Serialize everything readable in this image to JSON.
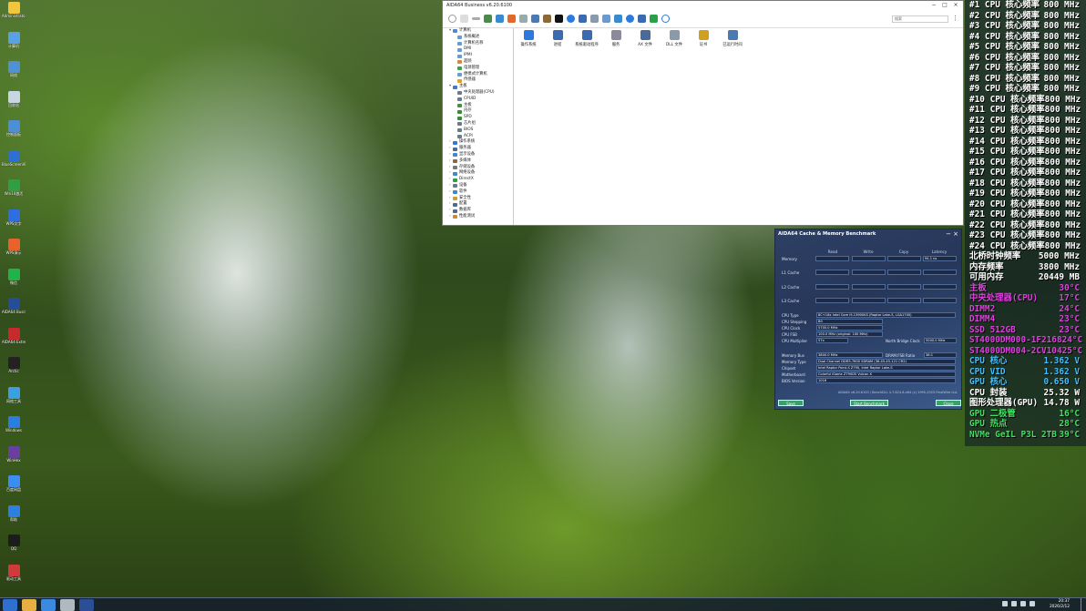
{
  "desktop_icons": [
    {
      "label": "Administrator",
      "icon": "user-folder-icon",
      "color": "#f3c53d"
    },
    {
      "label": "计算机",
      "icon": "computer-icon",
      "color": "#5aa0e6"
    },
    {
      "label": "网络",
      "icon": "network-icon",
      "color": "#4f90d6"
    },
    {
      "label": "回收站",
      "icon": "recycle-bin-icon",
      "color": "#c8d6e4"
    },
    {
      "label": "控制面板",
      "icon": "control-panel-icon",
      "color": "#4c8fd8"
    },
    {
      "label": "BlueScreenView",
      "icon": "bluescreen-icon",
      "color": "#2f6fd0"
    },
    {
      "label": "Win10激活",
      "icon": "activation-icon",
      "color": "#2ea043"
    },
    {
      "label": "WPS文字",
      "icon": "wps-writer-icon",
      "color": "#2f6ee0"
    },
    {
      "label": "WPS演示",
      "icon": "wps-presentation-icon",
      "color": "#e8632c"
    },
    {
      "label": "微信",
      "icon": "wechat-icon",
      "color": "#20b34a"
    },
    {
      "label": "AIDA64 Business",
      "icon": "aida64-icon",
      "color": "#254d9a"
    },
    {
      "label": "AIDA64 Extreme",
      "icon": "aida64-red-icon",
      "color": "#c72a2a"
    },
    {
      "label": "Arctic",
      "icon": "arctic-icon",
      "color": "#222222"
    },
    {
      "label": "网络工具",
      "icon": "net-tool-icon",
      "color": "#3aa0e0"
    },
    {
      "label": "Windows",
      "icon": "windows-icon",
      "color": "#2a7ee0"
    },
    {
      "label": "WinHex",
      "icon": "winhex-icon",
      "color": "#6b3fa0"
    },
    {
      "label": "百度网盘",
      "icon": "baidu-disk-icon",
      "color": "#3b8ef0"
    },
    {
      "label": "帮助",
      "icon": "help-icon",
      "color": "#2f7fe0"
    },
    {
      "label": "QQ",
      "icon": "qq-icon",
      "color": "#1c1c1c"
    },
    {
      "label": "驱动工具",
      "icon": "driver-tool-icon",
      "color": "#d03a3a"
    }
  ],
  "aida_window": {
    "title": "AIDA64 Business v6.20.6100",
    "search_placeholder": "搜索",
    "tree": [
      {
        "label": "计算机",
        "icon": "computer-icon",
        "color": "#4a8ad8"
      },
      {
        "label": "系统概述",
        "icon": "summary-icon",
        "color": "#6a9ad0"
      },
      {
        "label": "计算机名称",
        "icon": "pcname-icon",
        "color": "#6a9ad0"
      },
      {
        "label": "DMI",
        "icon": "dmi-icon",
        "color": "#6a9ad0"
      },
      {
        "label": "IPMI",
        "icon": "ipmi-icon",
        "color": "#6a9ad0"
      },
      {
        "label": "超频",
        "icon": "overclock-icon",
        "color": "#d08a3a"
      },
      {
        "label": "电源管理",
        "icon": "power-icon",
        "color": "#3aa04a"
      },
      {
        "label": "便携式计算机",
        "icon": "laptop-icon",
        "color": "#6a9ad0"
      },
      {
        "label": "传感器",
        "icon": "sensor-icon",
        "color": "#e0a020"
      },
      {
        "label": "主板",
        "icon": "motherboard-icon",
        "color": "#3a7ad0"
      },
      {
        "label": "中央处理器(CPU)",
        "icon": "cpu-icon",
        "color": "#6a7a8a"
      },
      {
        "label": "CPUID",
        "icon": "cpuid-icon",
        "color": "#6a7a8a"
      },
      {
        "label": "主板",
        "icon": "board-icon",
        "color": "#4a8a4a"
      },
      {
        "label": "内存",
        "icon": "memory-icon",
        "color": "#3a8a3a"
      },
      {
        "label": "SPD",
        "icon": "spd-icon",
        "color": "#3a8a3a"
      },
      {
        "label": "芯片组",
        "icon": "chipset-icon",
        "color": "#6a7a8a"
      },
      {
        "label": "BIOS",
        "icon": "bios-icon",
        "color": "#6a7a8a"
      },
      {
        "label": "ACPI",
        "icon": "acpi-icon",
        "color": "#6a7a8a"
      },
      {
        "label": "操作系统",
        "icon": "os-icon",
        "color": "#2a7ae0"
      },
      {
        "label": "服务器",
        "icon": "server-icon",
        "color": "#4a6a9a"
      },
      {
        "label": "显示设备",
        "icon": "display-icon",
        "color": "#3a8ad0"
      },
      {
        "label": "多媒体",
        "icon": "multimedia-icon",
        "color": "#8a6a3a"
      },
      {
        "label": "存储设备",
        "icon": "storage-icon",
        "color": "#6a7a8a"
      },
      {
        "label": "网络设备",
        "icon": "network-icon",
        "color": "#3a8ad0"
      },
      {
        "label": "DirectX",
        "icon": "directx-icon",
        "color": "#2aa04a"
      },
      {
        "label": "设备",
        "icon": "devices-icon",
        "color": "#6a7a8a"
      },
      {
        "label": "软件",
        "icon": "software-icon",
        "color": "#3a8ad0"
      },
      {
        "label": "安全性",
        "icon": "security-icon",
        "color": "#d0a020"
      },
      {
        "label": "配置",
        "icon": "config-icon",
        "color": "#4a6a9a"
      },
      {
        "label": "数据库",
        "icon": "database-icon",
        "color": "#4a6a9a"
      },
      {
        "label": "性能测试",
        "icon": "benchmark-icon",
        "color": "#d08a2a"
      }
    ],
    "panel": [
      {
        "label": "操作系统",
        "icon": "windows-icon",
        "color": "#2a7ae0"
      },
      {
        "label": "进程",
        "icon": "process-icon",
        "color": "#3a6ab0"
      },
      {
        "label": "系统驱动程序",
        "icon": "driver-icon",
        "color": "#3a6ab0"
      },
      {
        "label": "服务",
        "icon": "service-icon",
        "color": "#8a8a9a"
      },
      {
        "label": "AX 文件",
        "icon": "ax-file-icon",
        "color": "#4a6a9a"
      },
      {
        "label": "DLL 文件",
        "icon": "dll-file-icon",
        "color": "#8a9aaa"
      },
      {
        "label": "证书",
        "icon": "certificate-icon",
        "color": "#d0a020"
      },
      {
        "label": "已运行时间",
        "icon": "uptime-icon",
        "color": "#4a7ab0"
      }
    ]
  },
  "benchmark": {
    "title": "AIDA64 Cache & Memory Benchmark",
    "columns": [
      "Read",
      "Write",
      "Copy",
      "Latency"
    ],
    "rows": [
      "Memory",
      "L1 Cache",
      "L2 Cache",
      "L3 Cache"
    ],
    "memory_latency": "94.1 ns",
    "info": [
      {
        "label": "CPU Type",
        "value": "8C+16x Intel Core i9-13900KS (Raptor Lake-S, LGA1700)"
      },
      {
        "label": "CPU Stepping",
        "value": "B0"
      },
      {
        "label": "CPU Clock",
        "value": "5700.0 MHz"
      },
      {
        "label": "CPU FSB",
        "value": "100.0 MHz  (original: 100 MHz)"
      },
      {
        "label": "CPU Multiplier",
        "value": "57x"
      },
      {
        "label": "Memory Bus",
        "value": "3800.0 MHz"
      },
      {
        "label": "Memory Type",
        "value": "Dual Channel DDR5-7600 SDRAM  (36-45-45-121 CR2)"
      },
      {
        "label": "Chipset",
        "value": "Intel Raptor Point-S Z790, Intel Raptor Lake-S"
      },
      {
        "label": "Motherboard",
        "value": "Colorful iGame Z790D5 Vulcan X"
      },
      {
        "label": "BIOS Version",
        "value": "1016"
      }
    ],
    "nb_clock_label": "North Bridge Clock",
    "nb_clock_value": "5000.0 MHz",
    "ratio_label": "DRAM:FSB Ratio",
    "ratio_value": "38:1",
    "footer": "AIDA64 v6.20.6100 / BenchDLL 4.7.824.8-x64 (c) 1995-2025 FinalWire Ltd.",
    "btn_save": "Save",
    "btn_start": "Start Benchmark",
    "btn_close": "Close"
  },
  "osd": [
    {
      "label": "#1 CPU 核心频率",
      "value": "800 MHz",
      "color": "#ffffff"
    },
    {
      "label": "#2 CPU 核心频率",
      "value": "800 MHz",
      "color": "#ffffff"
    },
    {
      "label": "#3 CPU 核心频率",
      "value": "800 MHz",
      "color": "#ffffff"
    },
    {
      "label": "#4 CPU 核心频率",
      "value": "800 MHz",
      "color": "#ffffff"
    },
    {
      "label": "#5 CPU 核心频率",
      "value": "800 MHz",
      "color": "#ffffff"
    },
    {
      "label": "#6 CPU 核心频率",
      "value": "800 MHz",
      "color": "#ffffff"
    },
    {
      "label": "#7 CPU 核心频率",
      "value": "800 MHz",
      "color": "#ffffff"
    },
    {
      "label": "#8 CPU 核心频率",
      "value": "800 MHz",
      "color": "#ffffff"
    },
    {
      "label": "#9 CPU 核心频率",
      "value": "800 MHz",
      "color": "#ffffff"
    },
    {
      "label": "#10 CPU 核心频率",
      "value": "800 MHz",
      "color": "#ffffff"
    },
    {
      "label": "#11 CPU 核心频率",
      "value": "800 MHz",
      "color": "#ffffff"
    },
    {
      "label": "#12 CPU 核心频率",
      "value": "800 MHz",
      "color": "#ffffff"
    },
    {
      "label": "#13 CPU 核心频率",
      "value": "800 MHz",
      "color": "#ffffff"
    },
    {
      "label": "#14 CPU 核心频率",
      "value": "800 MHz",
      "color": "#ffffff"
    },
    {
      "label": "#15 CPU 核心频率",
      "value": "800 MHz",
      "color": "#ffffff"
    },
    {
      "label": "#16 CPU 核心频率",
      "value": "800 MHz",
      "color": "#ffffff"
    },
    {
      "label": "#17 CPU 核心频率",
      "value": "800 MHz",
      "color": "#ffffff"
    },
    {
      "label": "#18 CPU 核心频率",
      "value": "800 MHz",
      "color": "#ffffff"
    },
    {
      "label": "#19 CPU 核心频率",
      "value": "800 MHz",
      "color": "#ffffff"
    },
    {
      "label": "#20 CPU 核心频率",
      "value": "800 MHz",
      "color": "#ffffff"
    },
    {
      "label": "#21 CPU 核心频率",
      "value": "800 MHz",
      "color": "#ffffff"
    },
    {
      "label": "#22 CPU 核心频率",
      "value": "800 MHz",
      "color": "#ffffff"
    },
    {
      "label": "#23 CPU 核心频率",
      "value": "800 MHz",
      "color": "#ffffff"
    },
    {
      "label": "#24 CPU 核心频率",
      "value": "800 MHz",
      "color": "#ffffff"
    },
    {
      "label": "北桥时钟频率",
      "value": "5000 MHz",
      "color": "#ffffff"
    },
    {
      "label": "内存频率",
      "value": "3800 MHz",
      "color": "#ffffff"
    },
    {
      "label": "可用内存",
      "value": "20449 MB",
      "color": "#ffffff"
    },
    {
      "label": "主板",
      "value": "30°C",
      "color": "#e040e0"
    },
    {
      "label": "中央处理器(CPU)",
      "value": "17°C",
      "color": "#e040e0"
    },
    {
      "label": "DIMM2",
      "value": "24°C",
      "color": "#e040e0"
    },
    {
      "label": "DIMM4",
      "value": "23°C",
      "color": "#e040e0"
    },
    {
      "label": "SSD 512GB",
      "value": "23°C",
      "color": "#e040e0"
    },
    {
      "label": "ST4000DM000-1F2168",
      "value": "24°C",
      "color": "#e040e0"
    },
    {
      "label": "ST4000DM004-2CV104",
      "value": "25°C",
      "color": "#e040e0"
    },
    {
      "label": "CPU 核心",
      "value": "1.362 V",
      "color": "#40c0ff"
    },
    {
      "label": "CPU VID",
      "value": "1.362 V",
      "color": "#40c0ff"
    },
    {
      "label": "GPU 核心",
      "value": "0.650 V",
      "color": "#40c0ff"
    },
    {
      "label": "CPU 封装",
      "value": "25.32 W",
      "color": "#ffffff"
    },
    {
      "label": "图形处理器(GPU)",
      "value": "14.78 W",
      "color": "#ffffff"
    },
    {
      "label": "GPU 二极管",
      "value": "16°C",
      "color": "#40e060"
    },
    {
      "label": "GPU 热点",
      "value": "28°C",
      "color": "#40e060"
    },
    {
      "label": "NVMe GeIL P3L 2TB",
      "value": "39°C",
      "color": "#40e060"
    }
  ],
  "taskbar": {
    "apps": [
      {
        "icon": "start-icon",
        "color": "#2f6fd0"
      },
      {
        "icon": "file-explorer-icon",
        "color": "#e6b040"
      },
      {
        "icon": "browser-icon",
        "color": "#3a8ae0"
      },
      {
        "icon": "tool-icon",
        "color": "#b0b8c0"
      },
      {
        "icon": "aida64-taskbar-icon",
        "color": "#2a4f96"
      }
    ],
    "time": "20:37",
    "date": "2026/2/12"
  }
}
